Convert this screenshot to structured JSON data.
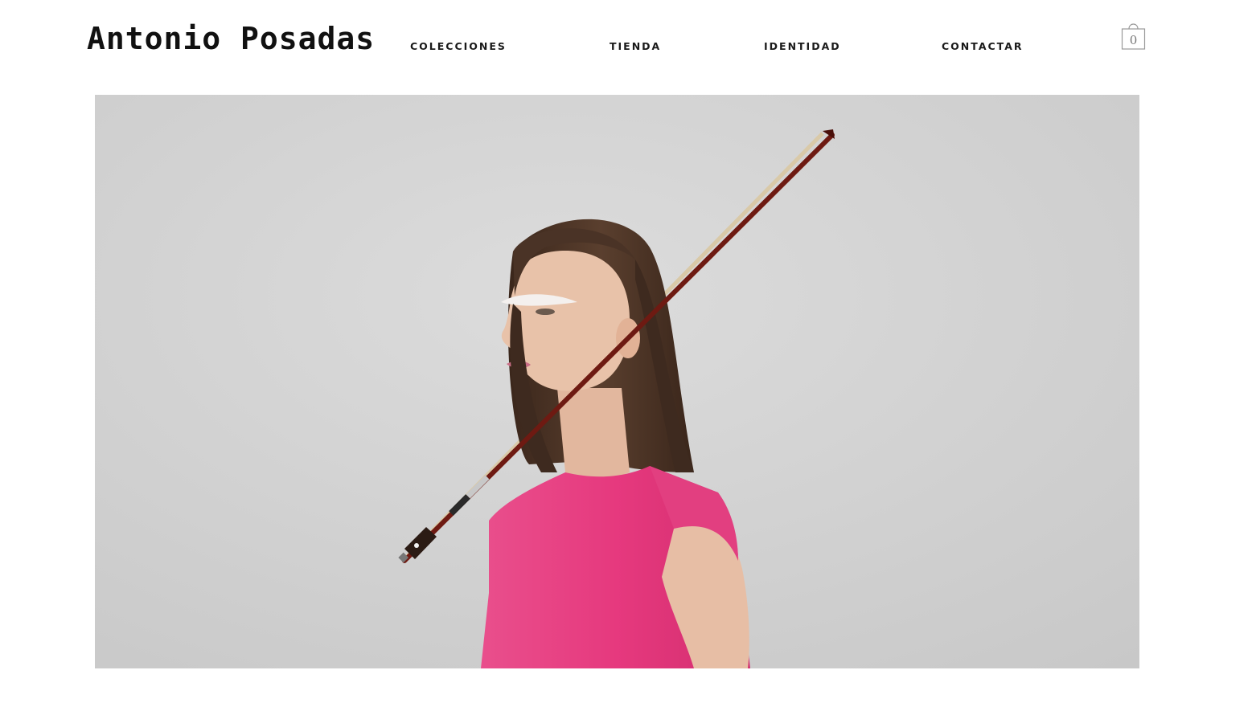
{
  "header": {
    "logo": "Antonio Posadas",
    "nav": [
      {
        "label": "COLECCIONES"
      },
      {
        "label": "TIENDA"
      },
      {
        "label": "IDENTIDAD"
      },
      {
        "label": "CONTACTAR"
      }
    ],
    "cart": {
      "icon": "shopping-bag-icon",
      "count": "0"
    }
  },
  "hero": {
    "image": "model-with-violin-bow-photo",
    "colors": {
      "background": "#d4d4d4",
      "dress": "#e6397e",
      "hair": "#4a3326",
      "skin": "#e6bfa7",
      "bow_stick": "#6e1a12",
      "bow_hair": "#d9c9a8"
    }
  }
}
